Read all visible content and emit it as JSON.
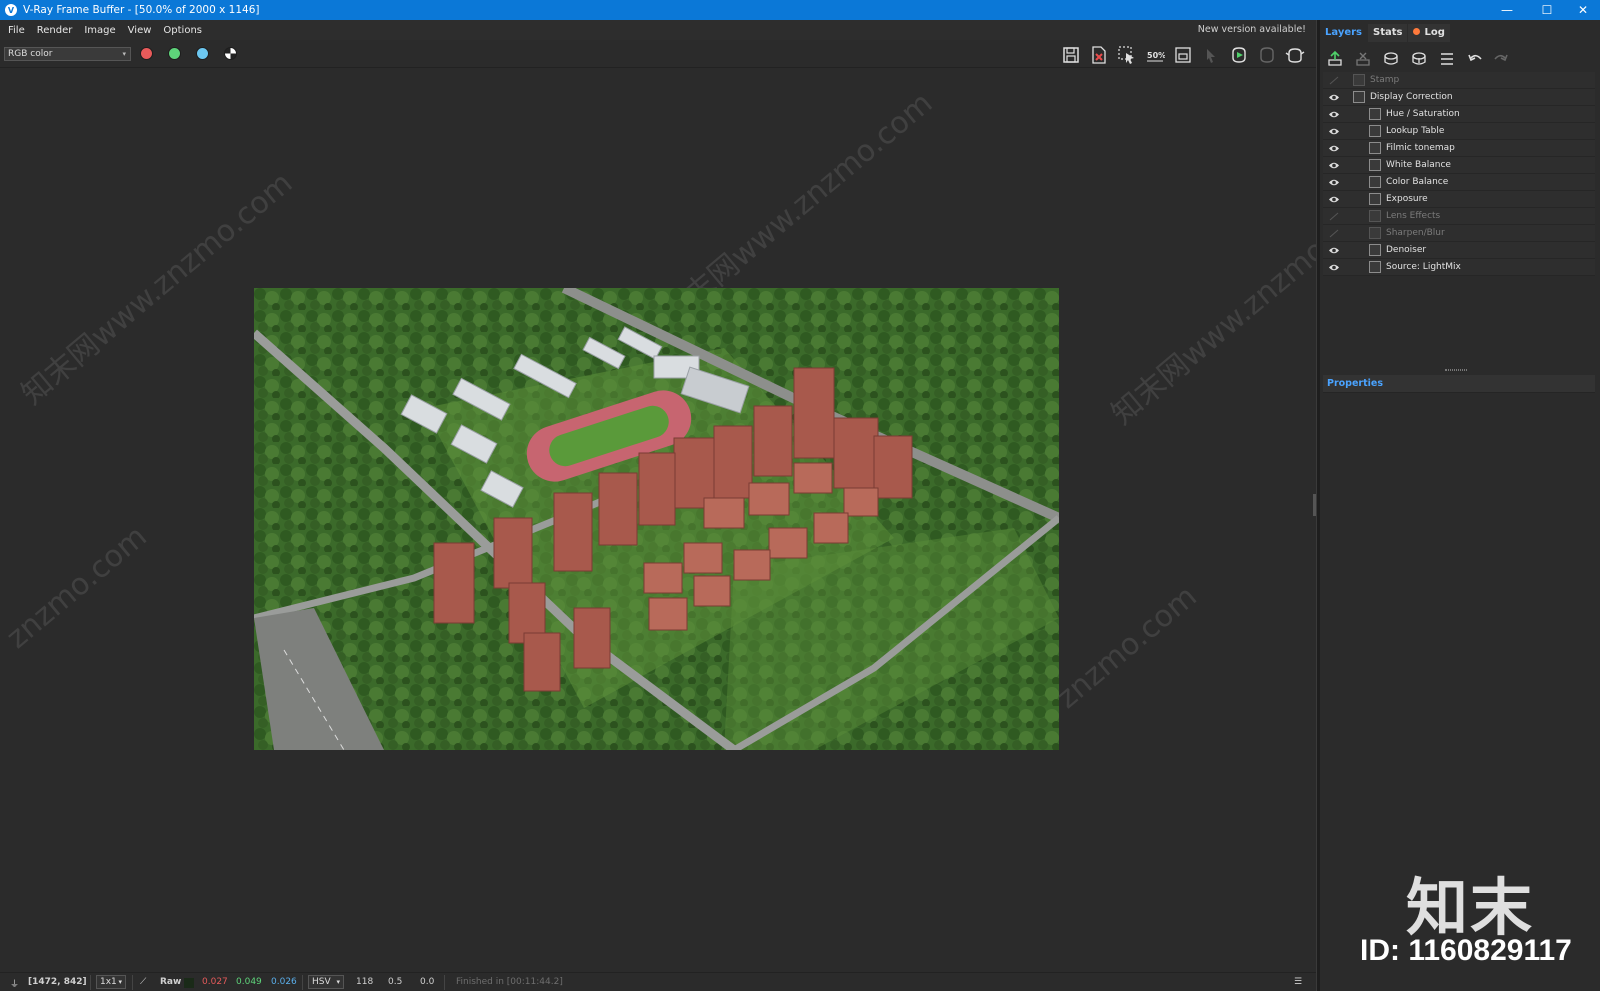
{
  "window": {
    "title": "V-Ray Frame Buffer - [50.0% of 2000 x 1146]",
    "minimize": "—",
    "maximize": "☐",
    "close": "✕"
  },
  "menu": [
    "File",
    "Render",
    "Image",
    "View",
    "Options"
  ],
  "notice": "New version available!",
  "toolbar": {
    "channel": "RGB color",
    "channel_dots": [
      {
        "name": "red-channel-button",
        "color": "#e85a5a"
      },
      {
        "name": "green-channel-button",
        "color": "#5ed37a"
      },
      {
        "name": "blue-channel-button",
        "color": "#6cc7f0"
      }
    ],
    "right_icons": [
      {
        "name": "save-image-icon"
      },
      {
        "name": "clear-image-icon"
      },
      {
        "name": "region-render-icon"
      },
      {
        "name": "test-resolution-icon",
        "label": "50%"
      },
      {
        "name": "compare-icon"
      },
      {
        "name": "track-mouse-icon"
      },
      {
        "name": "start-interactive-icon"
      },
      {
        "name": "stop-render-icon"
      },
      {
        "name": "render-teapot-icon"
      }
    ]
  },
  "panel": {
    "tabs": {
      "layers": "Layers",
      "stats": "Stats",
      "log": "Log"
    },
    "layers": [
      {
        "label": "Stamp",
        "visible": false,
        "indent": 0
      },
      {
        "label": "Display Correction",
        "visible": true,
        "indent": 0
      },
      {
        "label": "Hue / Saturation",
        "visible": true,
        "indent": 1
      },
      {
        "label": "Lookup Table",
        "visible": true,
        "indent": 1
      },
      {
        "label": "Filmic tonemap",
        "visible": true,
        "indent": 1
      },
      {
        "label": "White Balance",
        "visible": true,
        "indent": 1
      },
      {
        "label": "Color Balance",
        "visible": true,
        "indent": 1
      },
      {
        "label": "Exposure",
        "visible": true,
        "indent": 1
      },
      {
        "label": "Lens Effects",
        "visible": false,
        "indent": 1
      },
      {
        "label": "Sharpen/Blur",
        "visible": false,
        "indent": 1
      },
      {
        "label": "Denoiser",
        "visible": true,
        "indent": 1
      },
      {
        "label": "Source: LightMix",
        "visible": true,
        "indent": 1
      }
    ],
    "properties": "Properties"
  },
  "watermarks": {
    "site": "知末网www.znzmo.com",
    "site_short": "znzmo.com",
    "logo": "知末",
    "id": "ID: 1160829117"
  },
  "status": {
    "coords": "[1472, 842]",
    "zoom": "1x1",
    "mode": "Raw",
    "r": "0.027",
    "g": "0.049",
    "b": "0.026",
    "colorspace": "HSV",
    "h": "118",
    "s": "0.5",
    "v": "0.0",
    "finished": "Finished in [00:11:44.2]"
  }
}
